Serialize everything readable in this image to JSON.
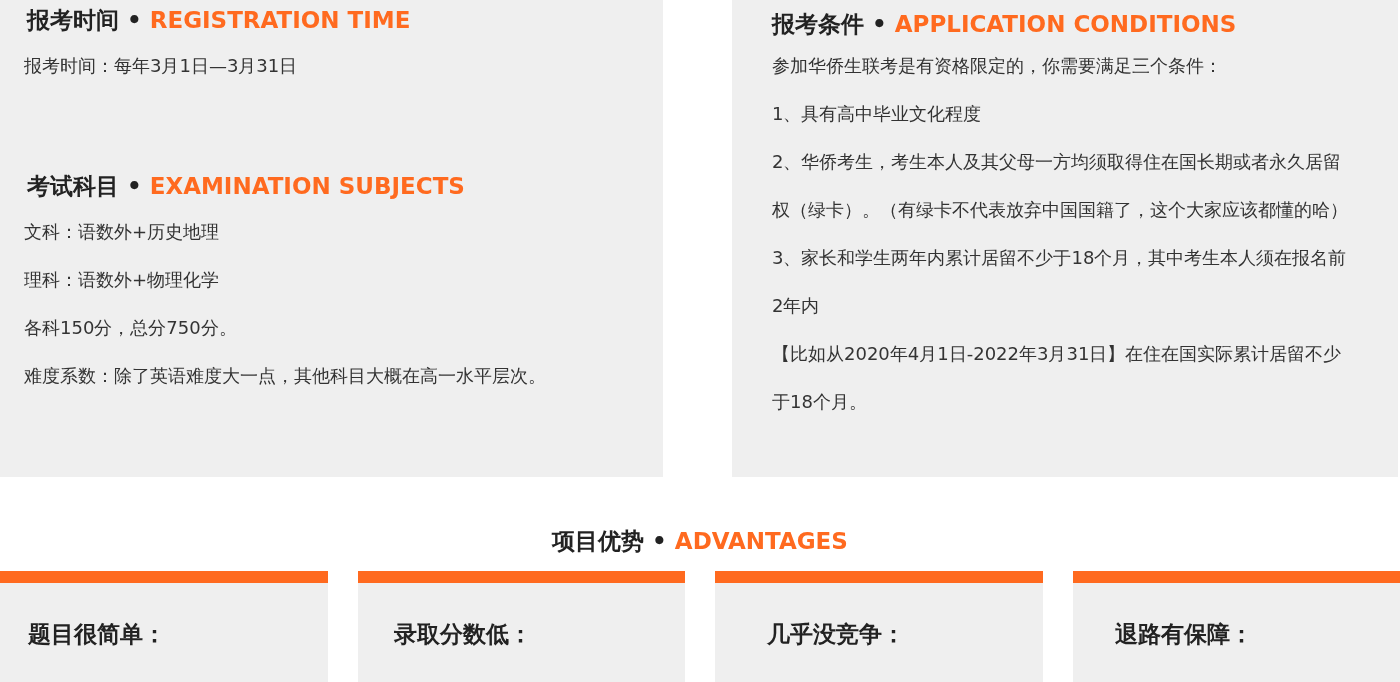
{
  "left_panel": {
    "sections": [
      {
        "title": "报考时间",
        "separator": "•",
        "title_en": "REGISTRATION TIME",
        "paragraphs": [
          "报考时间：每年3月1日—3月31日"
        ]
      },
      {
        "title": "考试科目",
        "separator": "•",
        "title_en": "EXAMINATION SUBJECTS",
        "paragraphs": [
          "文科：语数外+历史地理",
          "理科：语数外+物理化学",
          "各科150分，总分750分。",
          "难度系数：除了英语难度大一点，其他科目大概在高一水平层次。"
        ]
      }
    ]
  },
  "right_panel": {
    "sections": [
      {
        "title": "报考条件",
        "separator": "•",
        "title_en": "APPLICATION CONDITIONS",
        "paragraphs": [
          "参加华侨生联考是有资格限定的，你需要满足三个条件：",
          "1、具有高中毕业文化程度",
          "2、华侨考生，考生本人及其父母一方均须取得住在国长期或者永久居留权（绿卡）。（有绿卡不代表放弃中国国籍了，这个大家应该都懂的哈）",
          "3、家长和学生两年内累计居留不少于18个月，其中考生本人须在报名前2年内",
          "【比如从2020年4月1日-2022年3月31日】在住在国实际累计居留不少于18个月。"
        ]
      }
    ]
  },
  "advantages": {
    "title": "项目优势",
    "separator": "•",
    "title_en": "ADVANTAGES",
    "cards": [
      {
        "title": "题目很简单："
      },
      {
        "title": "录取分数低："
      },
      {
        "title": "几乎没竞争："
      },
      {
        "title": "退路有保障："
      }
    ]
  }
}
